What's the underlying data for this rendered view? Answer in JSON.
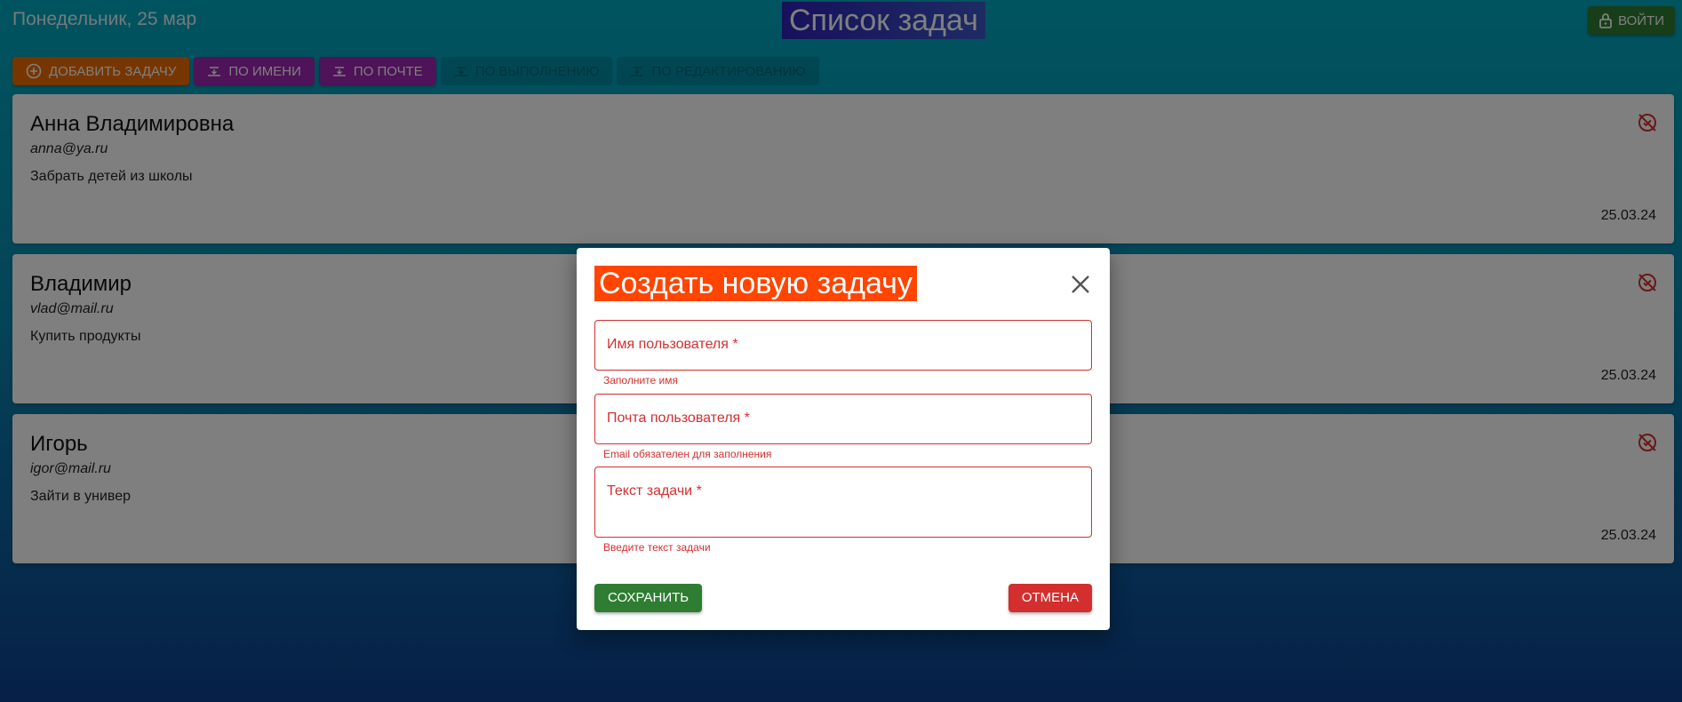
{
  "header": {
    "date": "Понедельник, 25 мар",
    "title": "Список задач",
    "login_label": "Войти"
  },
  "toolbar": {
    "add_label": "Добавить задачу",
    "sort_name_label": "По имени",
    "sort_email_label": "По почте",
    "sort_done_label": "По выполнению",
    "sort_edit_label": "По редактированию"
  },
  "tasks": [
    {
      "name": "Анна Владимировна",
      "email": "anna@ya.ru",
      "text": "Забрать детей из школы",
      "date": "25.03.24"
    },
    {
      "name": "Владимир",
      "email": "vlad@mail.ru",
      "text": "Купить продукты",
      "date": "25.03.24"
    },
    {
      "name": "Игорь",
      "email": "igor@mail.ru",
      "text": "Зайти в универ",
      "date": "25.03.24"
    }
  ],
  "modal": {
    "title": "Создать новую задачу",
    "fields": {
      "username": {
        "label": "Имя пользователя *",
        "error": "Заполните имя"
      },
      "email": {
        "label": "Почта пользователя *",
        "error": "Email обязателен для заполнения"
      },
      "text": {
        "label": "Текст задачи *",
        "error": "Введите текст задачи"
      }
    },
    "save_label": "Сохранить",
    "cancel_label": "Отмена"
  },
  "colors": {
    "accent_green": "#2e7d32",
    "accent_orange": "#ef6c00",
    "accent_purple": "#9c27b0",
    "error_red": "#d32f2f",
    "modal_title_bg": "#ff4500",
    "title_bg": "#2e22b8"
  },
  "icons": {
    "login": "lock-icon",
    "add": "add-circle-icon",
    "sort": "sort-icon",
    "task_status": "not-done-icon",
    "close": "close-icon"
  }
}
